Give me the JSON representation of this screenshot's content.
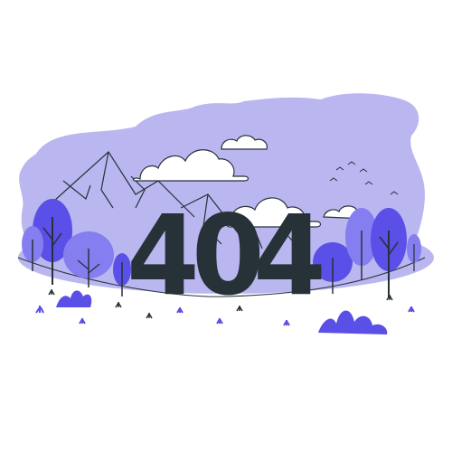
{
  "error": {
    "code_digits": [
      "4",
      "0",
      "4"
    ]
  },
  "colors": {
    "sky_blob": "#bab6f0",
    "tree_purple": "#5a4fe6",
    "tree_light": "#857ef0",
    "ink": "#263238",
    "outline": "#263238",
    "background": "#ffffff"
  },
  "icons": [
    "mountain-icon",
    "cloud-icon",
    "bird-icon",
    "tree-icon",
    "bush-icon",
    "grass-tuft-icon"
  ]
}
